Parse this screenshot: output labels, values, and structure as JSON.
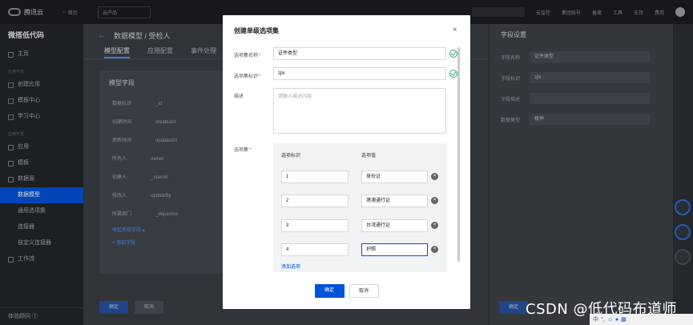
{
  "topbar": {
    "brand": "腾讯云",
    "home": "首页",
    "products": "云产品",
    "right_items": [
      "云监控",
      "集团账号",
      "备案",
      "工具",
      "支持",
      "费用"
    ]
  },
  "sidebar": {
    "title": "微搭低代码",
    "items": [
      {
        "label": "主页"
      },
      {
        "group": "应用开发"
      },
      {
        "label": "创建应用"
      },
      {
        "label": "模板中心"
      },
      {
        "label": "学习中心"
      },
      {
        "group": "应用开发"
      },
      {
        "label": "应用"
      },
      {
        "label": "模板"
      },
      {
        "label": "数据源"
      },
      {
        "label": "数据模型",
        "sub": true,
        "active": true
      },
      {
        "label": "通用选项集",
        "sub": true
      },
      {
        "label": "连接器",
        "sub": true
      },
      {
        "label": "自定义连接器",
        "sub": true
      },
      {
        "label": "工作流"
      }
    ],
    "footer": "体验顾问 ①"
  },
  "main": {
    "breadcrumb": "数据模型 / 受检人",
    "tabs": [
      "模型配置",
      "应用配置",
      "事件处理"
    ],
    "card_title": "模型字段",
    "rows": [
      {
        "name": "数据标识",
        "type": "_id"
      },
      {
        "name": "创建时间",
        "type": "createdAt"
      },
      {
        "name": "更新时间",
        "type": "updatedAt"
      },
      {
        "name": "所有人",
        "type": "owner"
      },
      {
        "name": "创建人",
        "type": "_openid"
      },
      {
        "name": "修改人",
        "type": "updateBy"
      },
      {
        "name": "所属部门",
        "type": "_departme"
      }
    ],
    "show_system": "收起系统字段 ▴",
    "add_field": "+ 添加字段",
    "ok": "确定",
    "cancel": "取消"
  },
  "rpanel": {
    "title": "字段设置",
    "rows": [
      {
        "label": "字段名称",
        "value": "证件类型"
      },
      {
        "label": "字段标识",
        "value": "zjlx"
      },
      {
        "label": "字段描述",
        "value": ""
      },
      {
        "label": "数据类型",
        "value": "枚举"
      }
    ],
    "ok": "确定"
  },
  "modal": {
    "title": "创建单级选项集",
    "close": "×",
    "name_label": "选项集名称",
    "name_value": "证件类型",
    "id_label": "选项集标识",
    "id_value": "zjlx",
    "desc_label": "描述",
    "desc_placeholder": "请输入描述内容",
    "options_label": "选项集",
    "col_id": "选项标识",
    "col_value": "选项值",
    "options": [
      {
        "id": "1",
        "value": "身份证"
      },
      {
        "id": "2",
        "value": "港澳通行证"
      },
      {
        "id": "3",
        "value": "台湾通行证"
      },
      {
        "id": "4",
        "value": "护照"
      }
    ],
    "add_option": "添加选项",
    "confirm": "确定",
    "cancel": "取消"
  },
  "watermark": "CSDN @低代码布道师"
}
